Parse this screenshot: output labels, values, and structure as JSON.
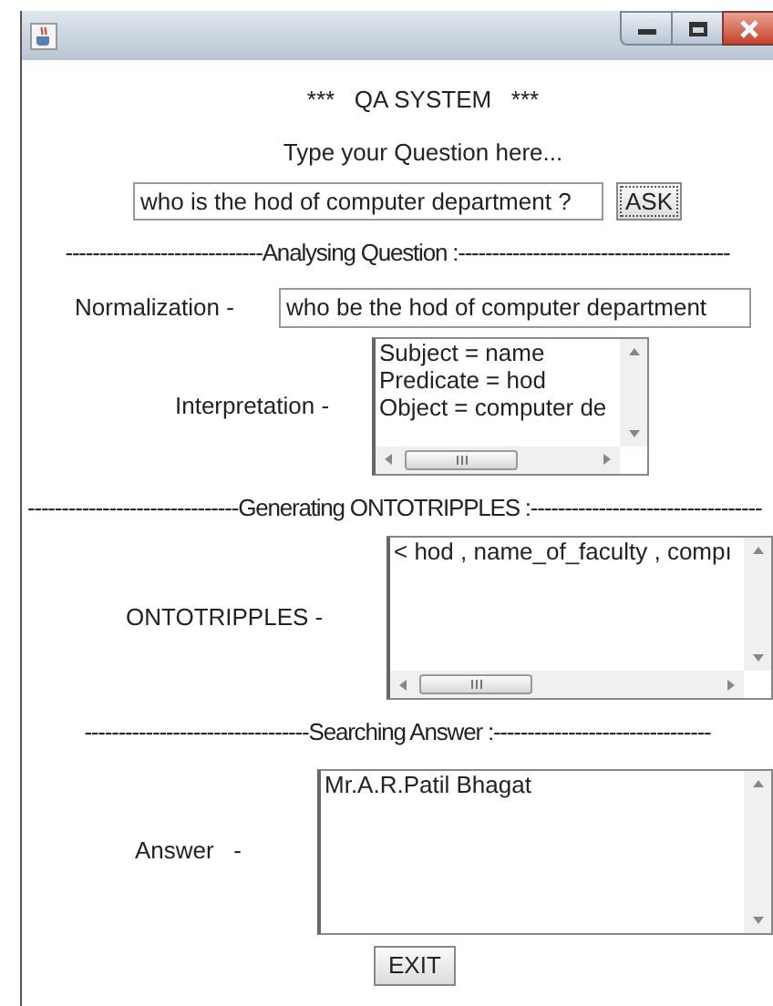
{
  "heading": "***   QA SYSTEM   ***",
  "prompt": "Type your Question here...",
  "question": {
    "value": "who is the hod of computer department ?"
  },
  "ask_button": "ASK",
  "sections": [
    {
      "kind": "divider",
      "text": "-----------------------------Analysing Question :----------------------------------------"
    },
    {
      "kind": "field",
      "label": "Normalization -",
      "value": "who be the hod of computer department"
    },
    {
      "kind": "scrollbox",
      "label": "Interpretation -",
      "lines": [
        "Subject = name",
        "Predicate = hod",
        "Object = computer de"
      ],
      "horizontal_scroll": true
    },
    {
      "kind": "divider",
      "text": "-------------------------------Generating ONTOTRIPPLES :----------------------------------"
    },
    {
      "kind": "scrollbox",
      "label": "ONTOTRIPPLES -",
      "lines": [
        "< hod , name_of_faculty , compı"
      ],
      "horizontal_scroll": true
    },
    {
      "kind": "divider",
      "text": "---------------------------------Searching Answer :--------------------------------"
    },
    {
      "kind": "scrollbox",
      "label": "Answer   -",
      "lines": [
        "Mr.A.R.Patil Bhagat"
      ],
      "horizontal_scroll": false
    }
  ],
  "exit_button": "EXIT"
}
